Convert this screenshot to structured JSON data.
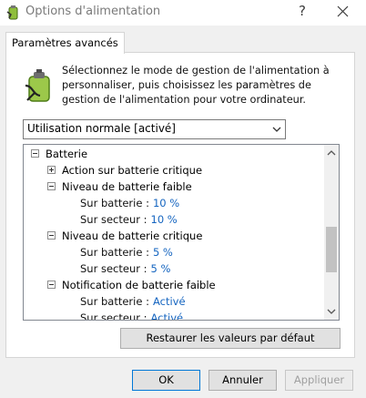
{
  "window": {
    "title": "Options d'alimentation",
    "help_glyph": "?",
    "close_glyph": "✕"
  },
  "tab": {
    "label": "Paramètres avancés"
  },
  "description": "Sélectionnez le mode de gestion de l'alimentation à personnaliser, puis choisissez les paramètres de gestion de l'alimentation pour votre ordinateur.",
  "plan_select": {
    "value": "Utilisation normale [activé]"
  },
  "tree": {
    "root": "Batterie",
    "n1": "Action sur batterie critique",
    "n2": "Niveau de batterie faible",
    "n2_s1_label": "Sur batterie :",
    "n2_s1_value": "10 %",
    "n2_s2_label": "Sur secteur :",
    "n2_s2_value": "10 %",
    "n3": "Niveau de batterie critique",
    "n3_s1_label": "Sur batterie :",
    "n3_s1_value": "5 %",
    "n3_s2_label": "Sur secteur :",
    "n3_s2_value": "5 %",
    "n4": "Notification de batterie faible",
    "n4_s1_label": "Sur batterie :",
    "n4_s1_value": "Activé",
    "n4_s2_label": "Sur secteur :",
    "n4_s2_value": "Activé"
  },
  "buttons": {
    "restore": "Restaurer les valeurs par défaut",
    "ok": "OK",
    "cancel": "Annuler",
    "apply": "Appliquer"
  },
  "colors": {
    "link_value": "#1565c0",
    "accent_border": "#0078d7"
  }
}
